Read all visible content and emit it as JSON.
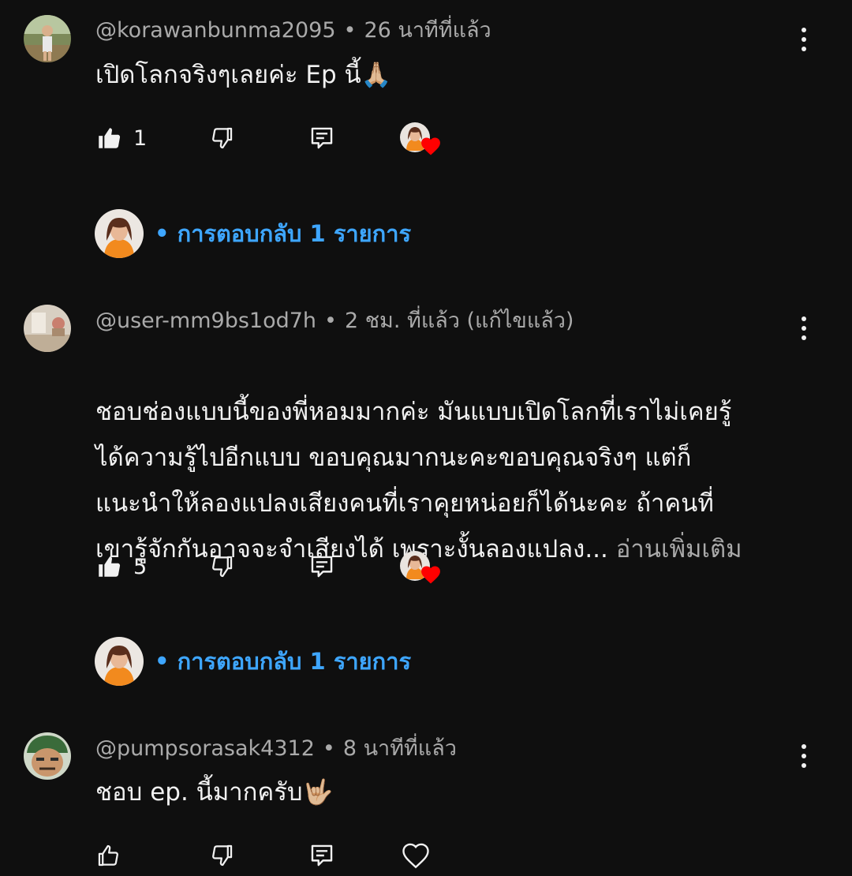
{
  "comments": [
    {
      "author": "@korawanbunma2095",
      "time": "26 นาทีที่แล้ว",
      "text": "เปิดโลกจริงๆเลยค่ะ Ep นี้🙏🏼",
      "likes": "1",
      "creator_hearted": true
    },
    {
      "author": "@user-mm9bs1od7h",
      "time": "2 ชม. ที่แล้ว (แก้ไขแล้ว)",
      "text": "ชอบช่องแบบนี้ของพี่หอมมากค่ะ มันแบบเปิดโลกที่เราไม่เคยรู้\nได้ความรู้ไปอีกแบบ ขอบคุณมากนะคะขอบคุณจริงๆ แต่ก็\nแนะนำให้ลองแปลงเสียงคนที่เราคุยหน่อยก็ได้นะคะ ถ้าคนที่\nเขารู้จักกันอาจจะจำเสียงได้ เพราะงั้นลองแปลง...",
      "read_more": "อ่านเพิ่มเติม",
      "likes": "5",
      "creator_hearted": true
    },
    {
      "author": "@pumpsorasak4312",
      "time": "8 นาทีที่แล้ว",
      "text": "ชอบ ep. นี้มากครับ🤟🏼",
      "likes": "",
      "creator_hearted": false
    }
  ],
  "replies": [
    {
      "label": "• การตอบกลับ 1 รายการ"
    },
    {
      "label": "• การตอบกลับ 1 รายการ"
    }
  ],
  "separator": "•",
  "icons": {
    "like": "thumbs-up-icon",
    "dislike": "thumbs-down-icon",
    "reply": "comment-reply-icon",
    "heart": "heart-icon",
    "more": "more-vertical-icon"
  },
  "colors": {
    "background": "#0f0f0f",
    "text": "#f1f1f1",
    "secondary": "#aaaaaa",
    "link": "#3ea6ff",
    "heart": "#ff0000",
    "creator_shirt": "#f28a1e"
  }
}
